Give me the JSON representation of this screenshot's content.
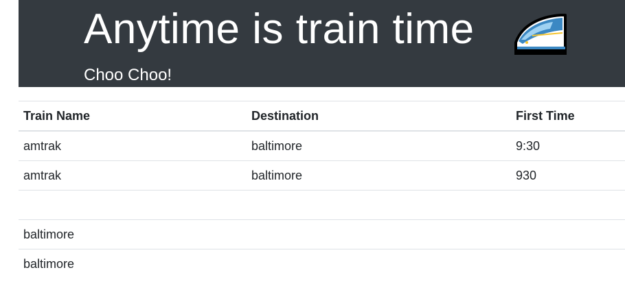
{
  "header": {
    "title": "Anytime is train time",
    "train_icon": "high-speed-train-icon",
    "subtitle": "Choo Choo!",
    "background": "#343a40"
  },
  "table": {
    "columns": [
      "Train Name",
      "Destination",
      "First Time"
    ],
    "rows": [
      [
        "amtrak",
        "baltimore",
        "9:30"
      ],
      [
        "amtrak",
        "baltimore",
        "930"
      ],
      [
        "",
        "",
        ""
      ],
      [
        "baltimore",
        "",
        ""
      ],
      [
        "baltimore",
        "",
        ""
      ]
    ]
  }
}
